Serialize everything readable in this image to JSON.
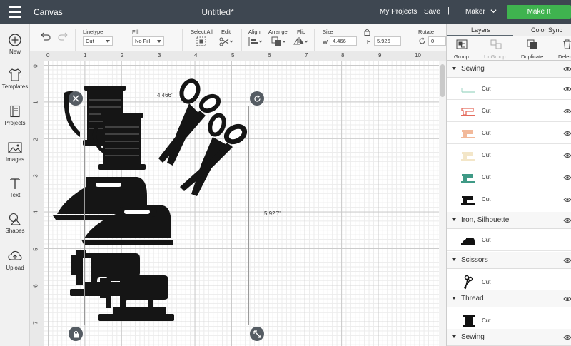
{
  "app": {
    "title": "Canvas",
    "document_title": "Untitled*",
    "menu_icon": "hamburger-icon"
  },
  "topnav": {
    "my_projects": "My Projects",
    "save": "Save",
    "separator": "|",
    "machine": "Maker",
    "make_it": "Make It",
    "make_it_color": "#3fb34f"
  },
  "sidebar": {
    "items": [
      {
        "label": "New",
        "icon": "plus-circle-icon"
      },
      {
        "label": "Templates",
        "icon": "shirt-icon"
      },
      {
        "label": "Projects",
        "icon": "projects-icon"
      },
      {
        "label": "Images",
        "icon": "image-icon"
      },
      {
        "label": "Text",
        "icon": "text-icon"
      },
      {
        "label": "Shapes",
        "icon": "shapes-icon"
      },
      {
        "label": "Upload",
        "icon": "cloud-upload-icon"
      }
    ]
  },
  "toolbar": {
    "linetype_label": "Linetype",
    "linetype_value": "Cut",
    "fill_label": "Fill",
    "fill_value": "No Fill",
    "select_all": "Select All",
    "edit": "Edit",
    "align": "Align",
    "arrange": "Arrange",
    "flip": "Flip",
    "size_label": "Size",
    "w_label": "W",
    "w_value": "4.466",
    "h_label": "H",
    "h_value": "5.926",
    "rotate_label": "Rotate",
    "rotate_value": "0"
  },
  "rulers": {
    "top": [
      "0",
      "1",
      "2",
      "3",
      "4",
      "5",
      "6",
      "7",
      "8",
      "9",
      "10"
    ],
    "left": [
      "0",
      "1",
      "2",
      "3",
      "4",
      "5",
      "6",
      "7"
    ]
  },
  "selection": {
    "width_label": "4.466\"",
    "height_label": "5.926\""
  },
  "panel": {
    "tabs": [
      "Layers",
      "Color Sync"
    ],
    "actions": [
      "Group",
      "UnGroup",
      "Duplicate",
      "Delete"
    ],
    "groups": [
      {
        "name": "Sewing",
        "rows": [
          {
            "label": "Cut",
            "thumb": "thread-teal",
            "color": "#9fd6c4"
          },
          {
            "label": "Cut",
            "thumb": "sewing-machine-red",
            "color": "#e46a5c"
          },
          {
            "label": "Cut",
            "thumb": "sewing-machine-peach",
            "color": "#f2b99a"
          },
          {
            "label": "Cut",
            "thumb": "sewing-machine-cream",
            "color": "#f3e6c8"
          },
          {
            "label": "Cut",
            "thumb": "sewing-machine-teal",
            "color": "#3f9a86"
          },
          {
            "label": "Cut",
            "thumb": "sewing-machine-black",
            "color": "#111111"
          }
        ]
      },
      {
        "name": "Iron, Silhouette",
        "rows": [
          {
            "label": "Cut",
            "thumb": "iron-black",
            "color": "#111111"
          }
        ]
      },
      {
        "name": "Scissors",
        "rows": [
          {
            "label": "Cut",
            "thumb": "scissors-black",
            "color": "#111111"
          }
        ]
      },
      {
        "name": "Thread",
        "rows": [
          {
            "label": "Cut",
            "thumb": "spool-black",
            "color": "#111111"
          }
        ]
      },
      {
        "name": "Sewing",
        "rows": []
      }
    ]
  }
}
